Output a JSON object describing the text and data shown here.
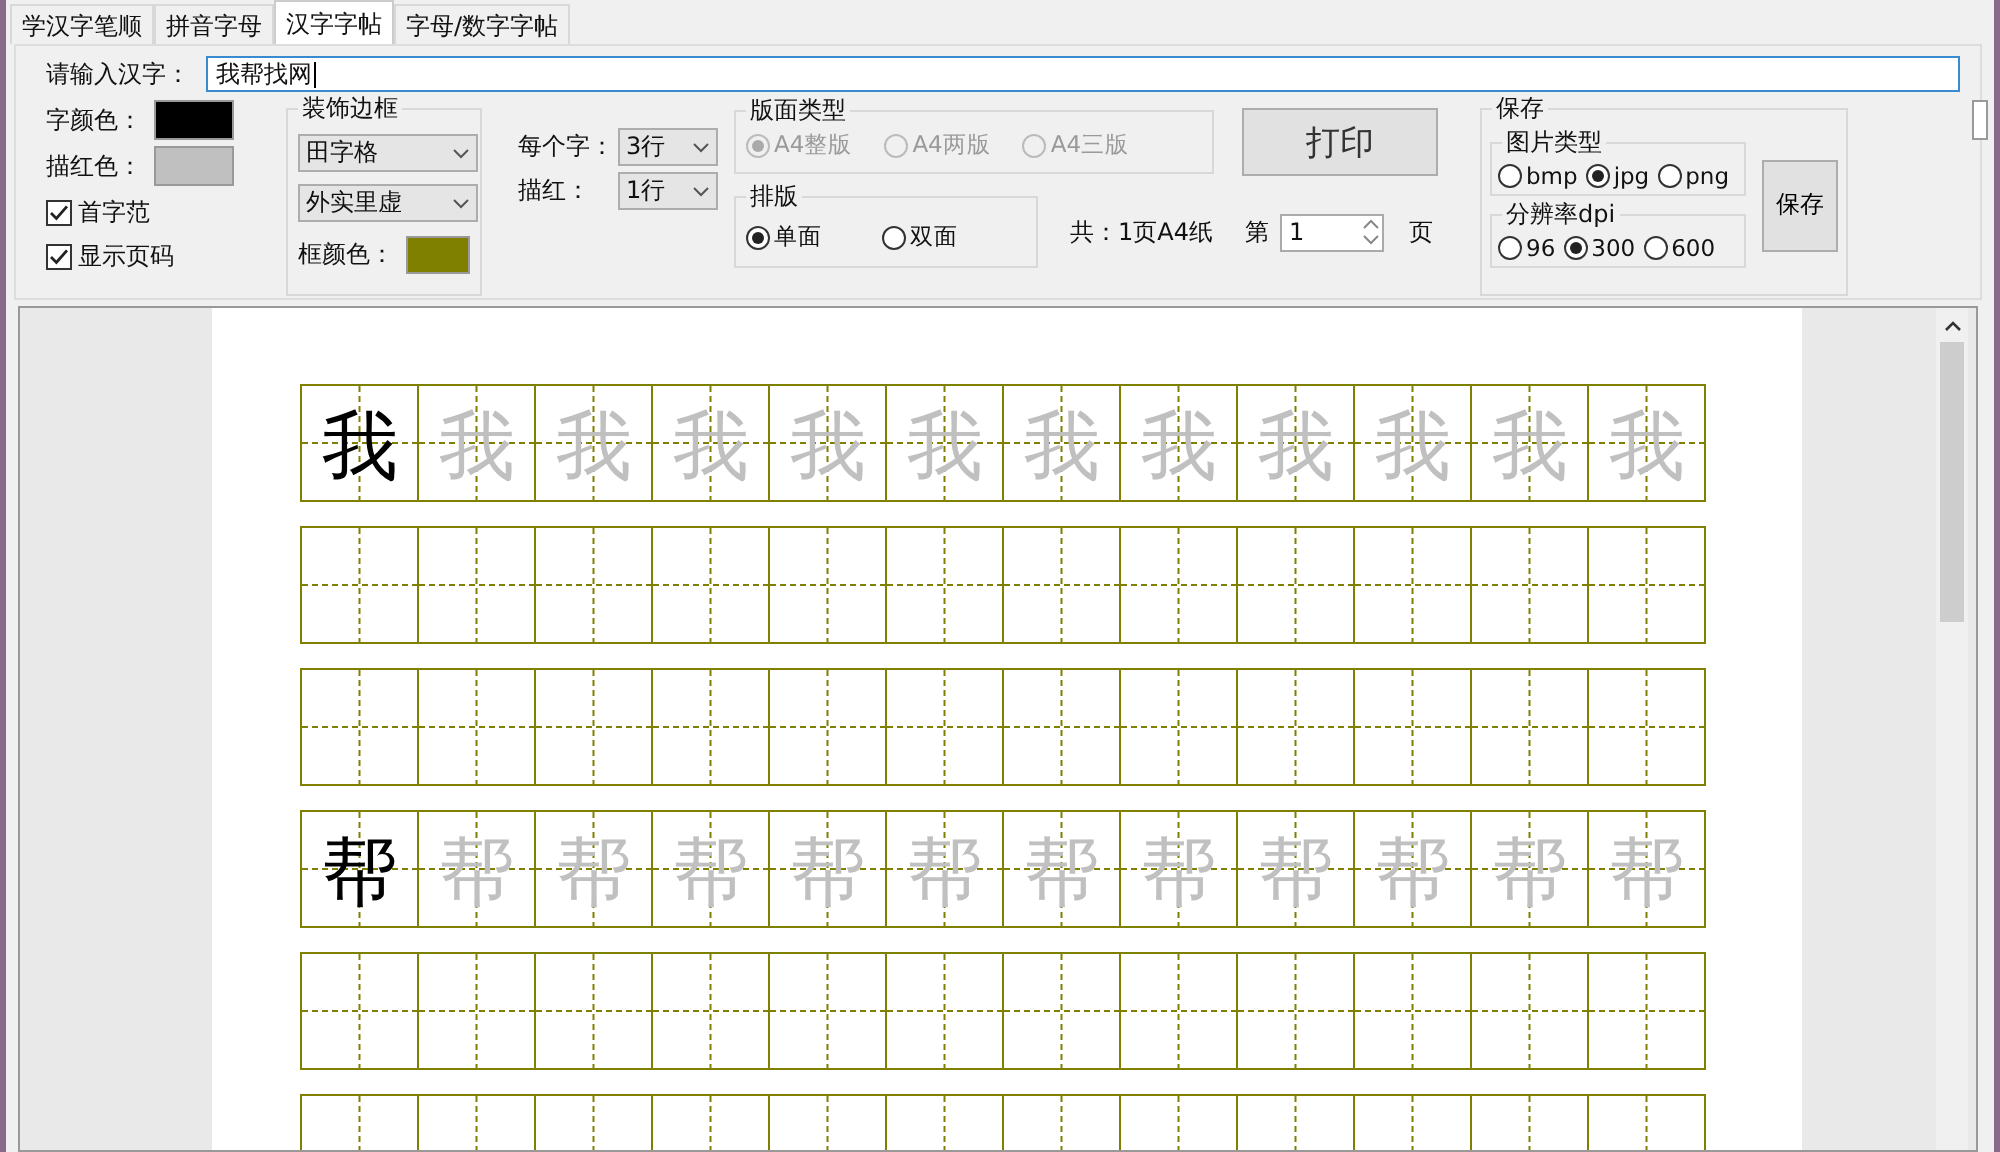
{
  "tabs": [
    {
      "label": "学汉字笔顺",
      "selected": false
    },
    {
      "label": "拼音字母",
      "selected": false
    },
    {
      "label": "汉字字帖",
      "selected": true
    },
    {
      "label": "字母/数字字帖",
      "selected": false
    }
  ],
  "input": {
    "label": "请输入汉字：",
    "value": "我帮找网"
  },
  "char_color": {
    "label": "字颜色：",
    "color": "#000000"
  },
  "trace_color": {
    "label": "描红色：",
    "color": "#c0c0c0"
  },
  "checkboxes": [
    {
      "label": "首字范",
      "checked": true
    },
    {
      "label": "显示页码",
      "checked": true
    }
  ],
  "border_group": {
    "title": "装饰边框",
    "grid_style": "田字格",
    "line_style": "外实里虚",
    "frame_color": {
      "label": "框颜色：",
      "color": "#808000"
    }
  },
  "rows_per_char": {
    "label": "每个字：",
    "value": "3行"
  },
  "trace_rows": {
    "label": "描红：",
    "value": "1行"
  },
  "layout_type": {
    "title": "版面类型",
    "disabled": true,
    "options": [
      {
        "label": "A4整版",
        "selected": true
      },
      {
        "label": "A4两版",
        "selected": false
      },
      {
        "label": "A4三版",
        "selected": false
      }
    ]
  },
  "print_button": "打印",
  "sides": {
    "title": "排版",
    "options": [
      {
        "label": "单面",
        "selected": true
      },
      {
        "label": "双面",
        "selected": false
      }
    ]
  },
  "total": "共：1页A4纸",
  "page": {
    "label": "第",
    "value": "1",
    "unit": "页"
  },
  "save": {
    "title": "保存",
    "image_type": {
      "title": "图片类型",
      "options": [
        {
          "label": "bmp",
          "selected": false
        },
        {
          "label": "jpg",
          "selected": true
        },
        {
          "label": "png",
          "selected": false
        }
      ]
    },
    "dpi": {
      "title": "分辨率dpi",
      "options": [
        {
          "label": "96",
          "selected": false
        },
        {
          "label": "300",
          "selected": true
        },
        {
          "label": "600",
          "selected": false
        }
      ]
    },
    "button": "保存"
  },
  "sheet": {
    "rows": [
      {
        "kind": "trace",
        "cells": [
          "我",
          "我",
          "我",
          "我",
          "我",
          "我",
          "我",
          "我",
          "我",
          "我",
          "我",
          "我"
        ]
      },
      {
        "kind": "blank"
      },
      {
        "kind": "blank"
      },
      {
        "kind": "trace",
        "cells": [
          "帮",
          "帮",
          "帮",
          "帮",
          "帮",
          "帮",
          "帮",
          "帮",
          "帮",
          "帮",
          "帮",
          "帮"
        ]
      },
      {
        "kind": "blank"
      },
      {
        "kind": "blank"
      }
    ]
  }
}
